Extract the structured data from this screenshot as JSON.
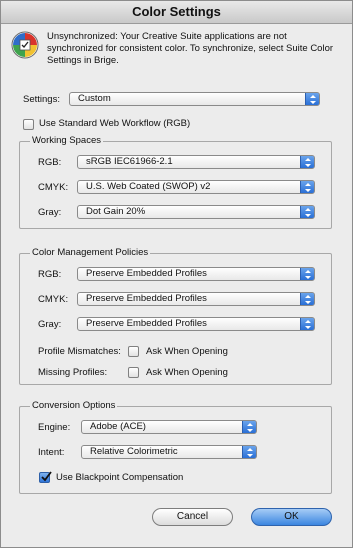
{
  "window": {
    "title": "Color Settings"
  },
  "sync": {
    "icon": "color-wheel-icon",
    "message": "Unsynchronized: Your Creative Suite applications are not synchronized for consistent color. To synchronize, select Suite Color Settings in Brige."
  },
  "settings": {
    "label": "Settings:",
    "value": "Custom"
  },
  "web_workflow": {
    "label": "Use Standard Web Workflow (RGB)",
    "checked": false
  },
  "working_spaces": {
    "title": "Working Spaces",
    "rgb": {
      "label": "RGB:",
      "value": "sRGB IEC61966-2.1"
    },
    "cmyk": {
      "label": "CMYK:",
      "value": "U.S. Web Coated (SWOP) v2"
    },
    "gray": {
      "label": "Gray:",
      "value": "Dot Gain 20%"
    }
  },
  "policies": {
    "title": "Color Management Policies",
    "rgb": {
      "label": "RGB:",
      "value": "Preserve Embedded Profiles"
    },
    "cmyk": {
      "label": "CMYK:",
      "value": "Preserve Embedded Profiles"
    },
    "gray": {
      "label": "Gray:",
      "value": "Preserve Embedded Profiles"
    },
    "profile_mismatches": {
      "label": "Profile Mismatches:",
      "option": "Ask When Opening",
      "checked": false
    },
    "missing_profiles": {
      "label": "Missing Profiles:",
      "option": "Ask When Opening",
      "checked": false
    }
  },
  "conversion": {
    "title": "Conversion Options",
    "engine": {
      "label": "Engine:",
      "value": "Adobe (ACE)"
    },
    "intent": {
      "label": "Intent:",
      "value": "Relative Colorimetric"
    },
    "blackpoint": {
      "label": "Use Blackpoint Compensation",
      "checked": true
    }
  },
  "buttons": {
    "cancel": "Cancel",
    "ok": "OK"
  },
  "colors": {
    "accent": "#3b86e0",
    "background": "#ececec"
  }
}
